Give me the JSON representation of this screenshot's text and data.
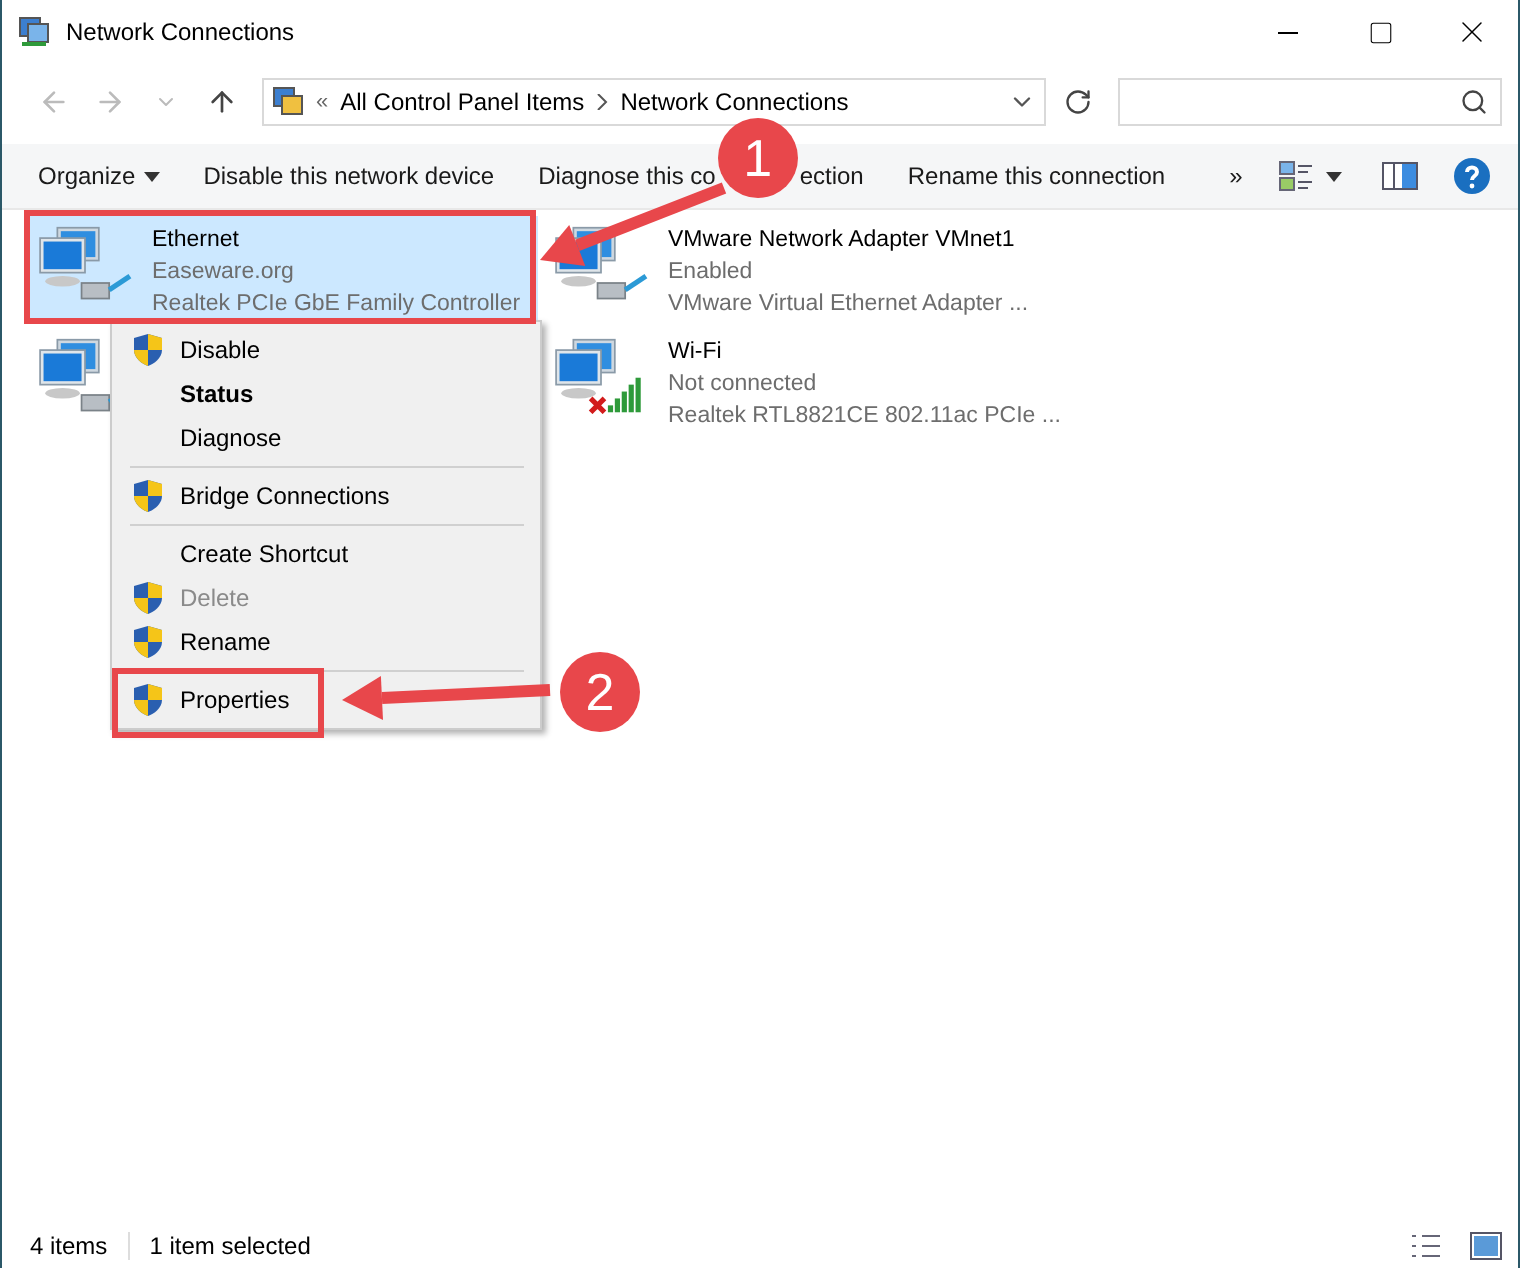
{
  "window": {
    "title": "Network Connections"
  },
  "address": {
    "overflow": "«",
    "breadcrumb": [
      "All Control Panel Items",
      "Network Connections"
    ]
  },
  "command_bar": {
    "items": [
      {
        "label": "Organize",
        "kind": "dropdown"
      },
      {
        "label": "Disable this network device",
        "kind": "command"
      },
      {
        "label": "Diagnose this co",
        "tail": "ection",
        "kind": "covered"
      },
      {
        "label": "Rename this connection",
        "kind": "command"
      },
      {
        "label": "»",
        "kind": "more"
      }
    ]
  },
  "adapters": [
    {
      "kind": "ethernet",
      "name": "Ethernet",
      "status": "Easeware.org",
      "device": "Realtek PCIe GbE Family Controller",
      "selected": true,
      "connected": true
    },
    {
      "kind": "ethernet",
      "name": "VMware Network Adapter VMnet1",
      "status": "Enabled",
      "device": "VMware Virtual Ethernet Adapter ...",
      "selected": false,
      "connected": true
    },
    {
      "kind": "ethernet"
    },
    {
      "kind": "wifi",
      "name": "Wi-Fi",
      "status": "Not connected",
      "device": "Realtek RTL8821CE 802.11ac PCIe ...",
      "selected": false,
      "connected": false
    }
  ],
  "context_menu": {
    "items": [
      {
        "kind": "item",
        "label": "Disable",
        "shield": true,
        "default": false,
        "disabled": false
      },
      {
        "kind": "item",
        "label": "Status",
        "shield": false,
        "default": true,
        "disabled": false
      },
      {
        "kind": "item",
        "label": "Diagnose",
        "shield": false,
        "default": false,
        "disabled": false
      },
      {
        "kind": "separator"
      },
      {
        "kind": "item",
        "label": "Bridge Connections",
        "shield": true,
        "default": false,
        "disabled": false
      },
      {
        "kind": "separator"
      },
      {
        "kind": "item",
        "label": "Create Shortcut",
        "shield": false,
        "default": false,
        "disabled": false
      },
      {
        "kind": "item",
        "label": "Delete",
        "shield": true,
        "default": false,
        "disabled": true
      },
      {
        "kind": "item",
        "label": "Rename",
        "shield": true,
        "default": false,
        "disabled": false
      },
      {
        "kind": "separator"
      },
      {
        "kind": "item",
        "label": "Properties",
        "shield": true,
        "default": false,
        "disabled": false
      }
    ]
  },
  "annotations": [
    {
      "label": "1"
    },
    {
      "label": "2"
    }
  ],
  "status_bar": [
    "4 items",
    "1 item selected"
  ]
}
